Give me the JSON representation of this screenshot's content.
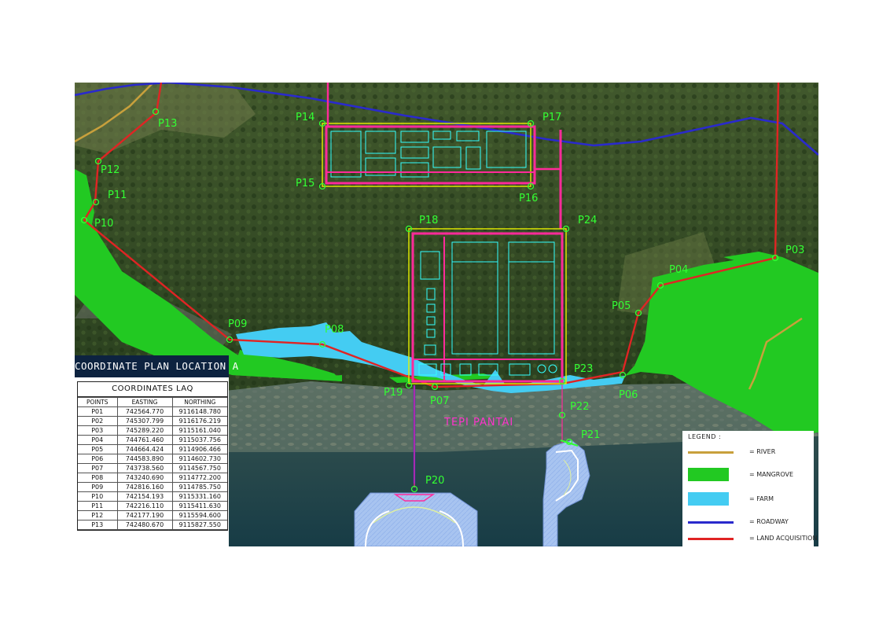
{
  "points": [
    {
      "id": "P01"
    },
    {
      "id": "P02"
    },
    {
      "id": "P03"
    },
    {
      "id": "P04"
    },
    {
      "id": "P05"
    },
    {
      "id": "P06"
    },
    {
      "id": "P07"
    },
    {
      "id": "P08"
    },
    {
      "id": "P09"
    },
    {
      "id": "P10"
    },
    {
      "id": "P11"
    },
    {
      "id": "P12"
    },
    {
      "id": "P13"
    },
    {
      "id": "P14"
    },
    {
      "id": "P15"
    },
    {
      "id": "P16"
    },
    {
      "id": "P17"
    },
    {
      "id": "P18"
    },
    {
      "id": "P19"
    },
    {
      "id": "P20"
    },
    {
      "id": "P21"
    },
    {
      "id": "P22"
    },
    {
      "id": "P23"
    },
    {
      "id": "P24"
    }
  ],
  "place_label": "TEPI PANTAI",
  "coordinate_panel": {
    "title": "COORDINATE PLAN LOCATION A",
    "table_title": "COORDINATES LAQ",
    "headers": [
      "POINTS",
      "EASTING",
      "NORTHING"
    ],
    "rows": [
      [
        "P01",
        "742564.770",
        "9116148.780"
      ],
      [
        "P02",
        "745307.799",
        "9116176.219"
      ],
      [
        "P03",
        "745289.220",
        "9115161.040"
      ],
      [
        "P04",
        "744761.460",
        "9115037.756"
      ],
      [
        "P05",
        "744664.424",
        "9114906.466"
      ],
      [
        "P06",
        "744583.890",
        "9114602.730"
      ],
      [
        "P07",
        "743738.560",
        "9114567.750"
      ],
      [
        "P08",
        "743240.690",
        "9114772.200"
      ],
      [
        "P09",
        "742816.160",
        "9114785.750"
      ],
      [
        "P10",
        "742154.193",
        "9115331.160"
      ],
      [
        "P11",
        "742216.110",
        "9115411.630"
      ],
      [
        "P12",
        "742177.190",
        "9115594.600"
      ],
      [
        "P13",
        "742480.670",
        "9115827.550"
      ]
    ]
  },
  "legend": {
    "title": "LEGEND :",
    "items": [
      {
        "key": "river",
        "label": "= RIVER",
        "color": "#c8a03c",
        "style": "line"
      },
      {
        "key": "mangrove",
        "label": "= MANGROVE",
        "color": "#22c922",
        "style": "fill"
      },
      {
        "key": "farm",
        "label": "= FARM",
        "color": "#44ccf2",
        "style": "fill"
      },
      {
        "key": "roadway",
        "label": "= ROADWAY",
        "color": "#2a2acc",
        "style": "line"
      },
      {
        "key": "land-acquisition",
        "label": "= LAND ACQUISITION",
        "color": "#e02424",
        "style": "line"
      }
    ]
  },
  "colors": {
    "forest": "#2f4a22",
    "sea": "#1f4a52",
    "reef": "#6d7a68",
    "point_marker": "#33ff33",
    "facility_outline": "#ff2a9a",
    "facility_inner": "#33ffff",
    "facility_boundary": "#e8f000",
    "jetty": "#a8c4f0"
  }
}
